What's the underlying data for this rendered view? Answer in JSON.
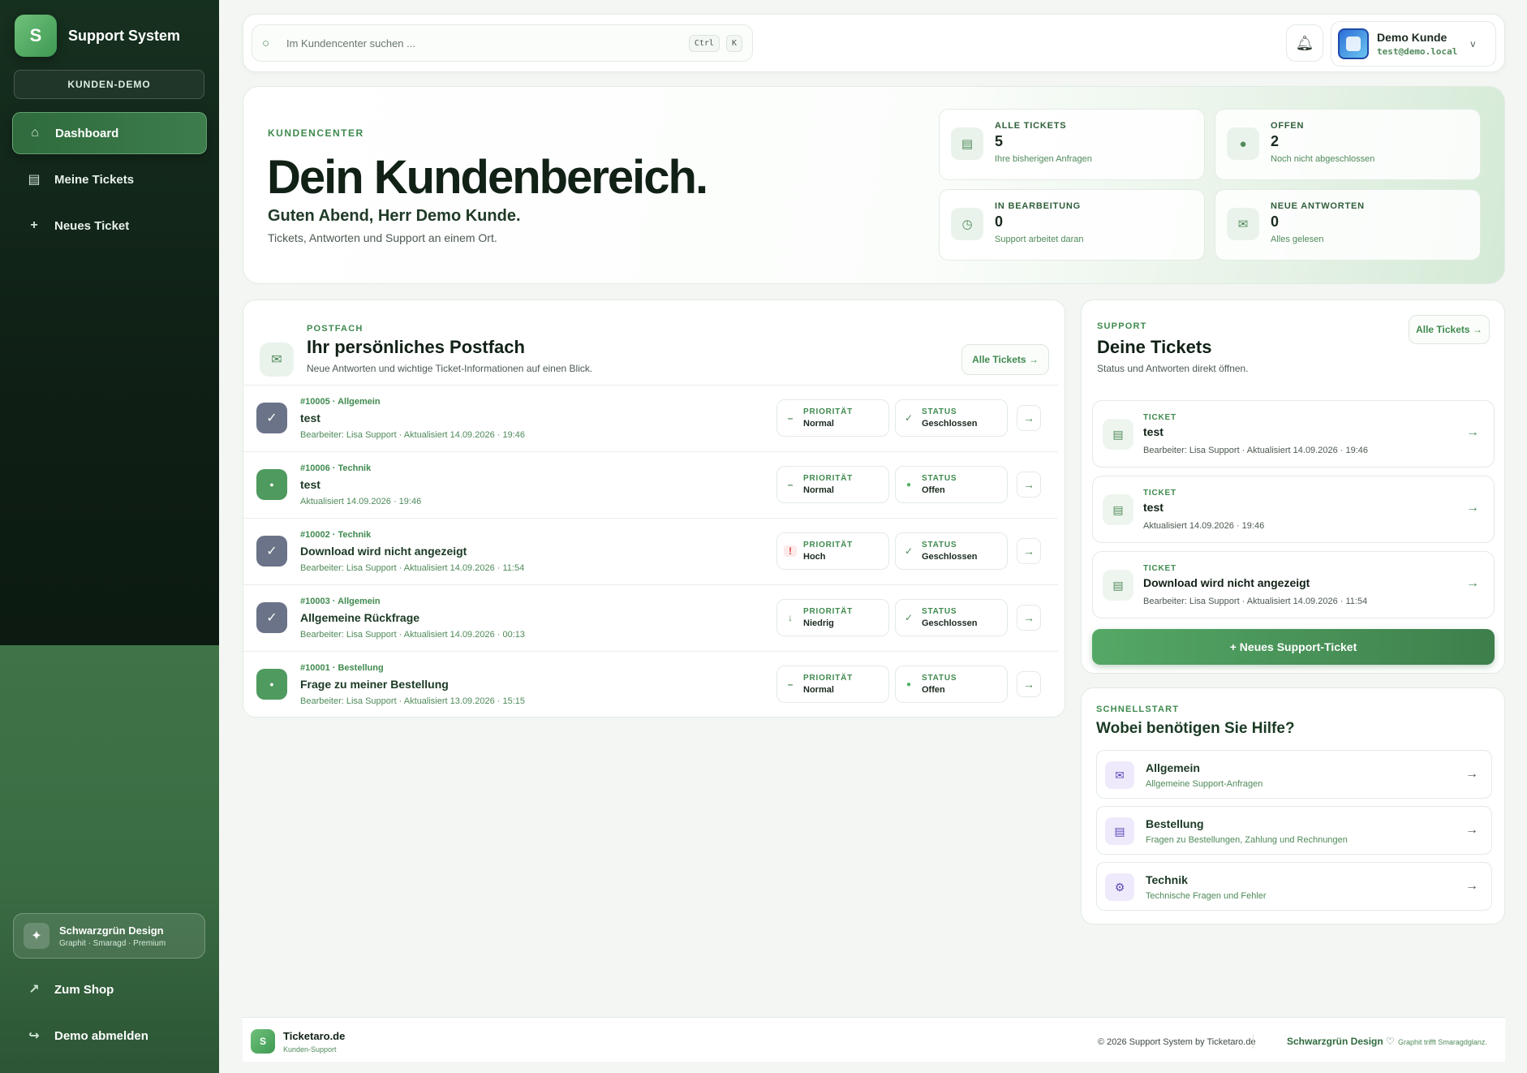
{
  "colors": {
    "accent": "#3f8a4e",
    "sidebar": "#0f1f15",
    "closed": "#6b7388",
    "open": "#4f9a5e"
  },
  "brand": {
    "logo_letter": "S",
    "name": "Support System"
  },
  "sidebar": {
    "badge": "KUNDEN-DEMO",
    "items": [
      {
        "label": "Dashboard",
        "icon": "home-icon",
        "active": true
      },
      {
        "label": "Meine Tickets",
        "icon": "list-icon"
      },
      {
        "label": "Neues Ticket",
        "icon": "plus-icon"
      }
    ],
    "theme": {
      "title": "Schwarzgrün Design",
      "subtitle": "Graphit · Smaragd · Premium",
      "icon": "sparkle-icon"
    },
    "bottom": [
      {
        "label": "Zum Shop",
        "icon": "arrow-up-right-icon"
      },
      {
        "label": "Demo abmelden",
        "icon": "logout-icon"
      }
    ]
  },
  "topbar": {
    "search_placeholder": "Im Kundencenter suchen ...",
    "kbd1": "Ctrl",
    "kbd2": "K",
    "user_name": "Demo Kunde",
    "user_email": "test@demo.local"
  },
  "hero": {
    "eyebrow": "KUNDENCENTER",
    "title": "Dein Kundenbereich.",
    "greeting": "Guten Abend, Herr Demo Kunde.",
    "subtitle": "Tickets, Antworten und Support an einem Ort.",
    "stats": [
      {
        "label": "ALLE TICKETS",
        "value": "5",
        "note": "Ihre bisherigen Anfragen",
        "icon": "list-icon"
      },
      {
        "label": "OFFEN",
        "value": "2",
        "note": "Noch nicht abgeschlossen",
        "icon": "dot-icon"
      },
      {
        "label": "IN BEARBEITUNG",
        "value": "0",
        "note": "Support arbeitet daran",
        "icon": "clock-icon"
      },
      {
        "label": "NEUE ANTWORTEN",
        "value": "0",
        "note": "Alles gelesen",
        "icon": "mail-icon"
      }
    ]
  },
  "inbox": {
    "eyebrow": "POSTFACH",
    "title": "Ihr persönliches Postfach",
    "subtitle": "Neue Antworten und wichtige Ticket-Informationen auf einen Blick.",
    "all_button": "Alle Tickets →",
    "prio_label": "PRIORITÄT",
    "status_label": "STATUS",
    "rows": [
      {
        "meta": "#10005 · Allgemein",
        "title": "test",
        "info": "Bearbeiter: Lisa Support · Aktualisiert 14.09.2026 · 19:46",
        "state": "closed",
        "prio": "Normal",
        "prio_kind": "normal",
        "status": "Geschlossen"
      },
      {
        "meta": "#10006 · Technik",
        "title": "test",
        "info": "Aktualisiert 14.09.2026 · 19:46",
        "state": "open",
        "prio": "Normal",
        "prio_kind": "normal",
        "status": "Offen"
      },
      {
        "meta": "#10002 · Technik",
        "title": "Download wird nicht angezeigt",
        "info": "Bearbeiter: Lisa Support · Aktualisiert 14.09.2026 · 11:54",
        "state": "closed",
        "prio": "Hoch",
        "prio_kind": "high",
        "status": "Geschlossen"
      },
      {
        "meta": "#10003 · Allgemein",
        "title": "Allgemeine Rückfrage",
        "info": "Bearbeiter: Lisa Support · Aktualisiert 14.09.2026 · 00:13",
        "state": "closed",
        "prio": "Niedrig",
        "prio_kind": "low",
        "status": "Geschlossen"
      },
      {
        "meta": "#10001 · Bestellung",
        "title": "Frage zu meiner Bestellung",
        "info": "Bearbeiter: Lisa Support · Aktualisiert 13.09.2026 · 15:15",
        "state": "open",
        "prio": "Normal",
        "prio_kind": "normal",
        "status": "Offen"
      }
    ]
  },
  "support": {
    "eyebrow": "SUPPORT",
    "title": "Deine Tickets",
    "subtitle": "Status und Antworten direkt öffnen.",
    "all_button": "Alle Tickets →",
    "cards": [
      {
        "label": "TICKET",
        "title": "test",
        "info": "Bearbeiter: Lisa Support · Aktualisiert 14.09.2026 · 19:46"
      },
      {
        "label": "TICKET",
        "title": "test",
        "info": "Aktualisiert 14.09.2026 · 19:46"
      },
      {
        "label": "TICKET",
        "title": "Download wird nicht angezeigt",
        "info": "Bearbeiter: Lisa Support · Aktualisiert 14.09.2026 · 11:54"
      }
    ],
    "cta": "+ Neues Support-Ticket"
  },
  "quick": {
    "eyebrow": "SCHNELLSTART",
    "title": "Wobei benötigen Sie Hilfe?",
    "items": [
      {
        "title": "Allgemein",
        "subtitle": "Allgemeine Support-Anfragen",
        "icon": "mail-icon"
      },
      {
        "title": "Bestellung",
        "subtitle": "Fragen zu Bestellungen, Zahlung und Rechnungen",
        "icon": "list-icon"
      },
      {
        "title": "Technik",
        "subtitle": "Technische Fragen und Fehler",
        "icon": "gear-icon"
      }
    ]
  },
  "footer": {
    "logo_letter": "S",
    "name": "Ticketaro.de",
    "subtitle": "Kunden-Support",
    "copyright": "© 2026 Support System by Ticketaro.de",
    "design": "Schwarzgrün Design ♡",
    "tagline": "Graphit trifft Smaragdglanz."
  }
}
